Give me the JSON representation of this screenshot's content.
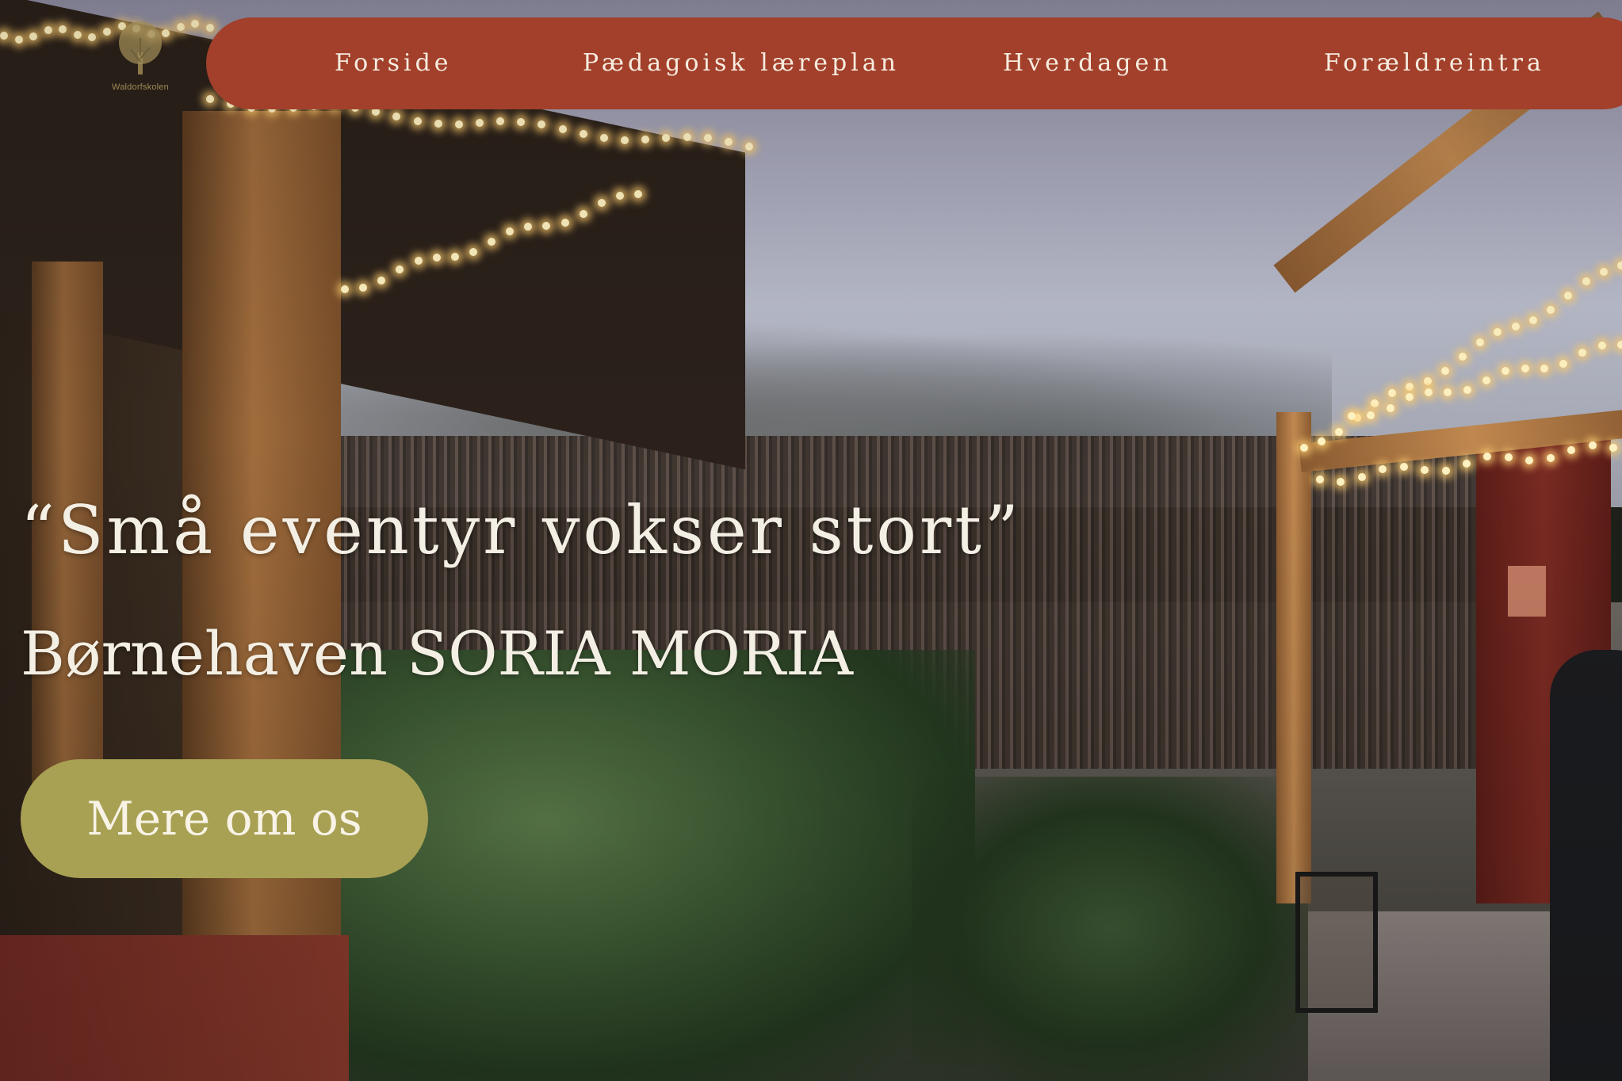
{
  "logo": {
    "text": "Waldorfskolen",
    "icon": "tree-icon"
  },
  "nav": {
    "items": [
      {
        "label": "Forside"
      },
      {
        "label": "Pædagoisk læreplan"
      },
      {
        "label": "Hverdagen"
      },
      {
        "label": "Forældreintra"
      }
    ]
  },
  "hero": {
    "quote": "“Små eventyr vokser stort”",
    "subtitle": "Børnehaven SORIA MORIA",
    "cta_label": "Mere om os"
  },
  "colors": {
    "nav_background": "#a2402b",
    "cta_background": "#a8a154",
    "text_light": "#f4efe4"
  }
}
